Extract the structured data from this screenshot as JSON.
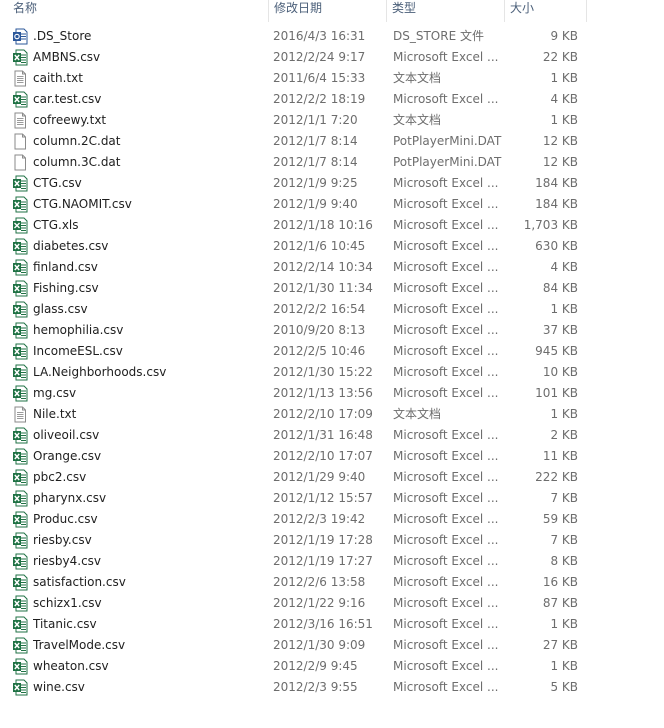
{
  "header": {
    "name_label": "名称",
    "date_label": "修改日期",
    "type_label": "类型",
    "size_label": "大小"
  },
  "colors": {
    "excel_green": "#1f7244",
    "header_text": "#4c607a",
    "secondary_text": "#6d6d6d"
  },
  "files": [
    {
      "name": ".DS_Store",
      "date": "2016/4/3 16:31",
      "type": "DS_STORE 文件",
      "size": "9 KB",
      "icon": "word-blue-icon"
    },
    {
      "name": "AMBNS.csv",
      "date": "2012/2/24 9:17",
      "type": "Microsoft Excel ...",
      "size": "22 KB",
      "icon": "excel-icon"
    },
    {
      "name": "caith.txt",
      "date": "2011/6/4 15:33",
      "type": "文本文档",
      "size": "1 KB",
      "icon": "text-file-icon"
    },
    {
      "name": "car.test.csv",
      "date": "2012/2/2 18:19",
      "type": "Microsoft Excel ...",
      "size": "4 KB",
      "icon": "excel-icon"
    },
    {
      "name": "cofreewy.txt",
      "date": "2012/1/1 7:20",
      "type": "文本文档",
      "size": "1 KB",
      "icon": "text-file-icon"
    },
    {
      "name": "column.2C.dat",
      "date": "2012/1/7 8:14",
      "type": "PotPlayerMini.DAT",
      "size": "12 KB",
      "icon": "blank-file-icon"
    },
    {
      "name": "column.3C.dat",
      "date": "2012/1/7 8:14",
      "type": "PotPlayerMini.DAT",
      "size": "12 KB",
      "icon": "blank-file-icon"
    },
    {
      "name": "CTG.csv",
      "date": "2012/1/9 9:25",
      "type": "Microsoft Excel ...",
      "size": "184 KB",
      "icon": "excel-icon"
    },
    {
      "name": "CTG.NAOMIT.csv",
      "date": "2012/1/9 9:40",
      "type": "Microsoft Excel ...",
      "size": "184 KB",
      "icon": "excel-icon"
    },
    {
      "name": "CTG.xls",
      "date": "2012/1/18 10:16",
      "type": "Microsoft Excel ...",
      "size": "1,703 KB",
      "icon": "excel-xls-icon"
    },
    {
      "name": "diabetes.csv",
      "date": "2012/1/6 10:45",
      "type": "Microsoft Excel ...",
      "size": "630 KB",
      "icon": "excel-icon"
    },
    {
      "name": "finland.csv",
      "date": "2012/2/14 10:34",
      "type": "Microsoft Excel ...",
      "size": "4 KB",
      "icon": "excel-icon"
    },
    {
      "name": "Fishing.csv",
      "date": "2012/1/30 11:34",
      "type": "Microsoft Excel ...",
      "size": "84 KB",
      "icon": "excel-icon"
    },
    {
      "name": "glass.csv",
      "date": "2012/2/2 16:54",
      "type": "Microsoft Excel ...",
      "size": "1 KB",
      "icon": "excel-icon"
    },
    {
      "name": "hemophilia.csv",
      "date": "2010/9/20 8:13",
      "type": "Microsoft Excel ...",
      "size": "37 KB",
      "icon": "excel-icon"
    },
    {
      "name": "IncomeESL.csv",
      "date": "2012/2/5 10:46",
      "type": "Microsoft Excel ...",
      "size": "945 KB",
      "icon": "excel-icon"
    },
    {
      "name": "LA.Neighborhoods.csv",
      "date": "2012/1/30 15:22",
      "type": "Microsoft Excel ...",
      "size": "10 KB",
      "icon": "excel-icon"
    },
    {
      "name": "mg.csv",
      "date": "2012/1/13 13:56",
      "type": "Microsoft Excel ...",
      "size": "101 KB",
      "icon": "excel-icon"
    },
    {
      "name": "Nile.txt",
      "date": "2012/2/10 17:09",
      "type": "文本文档",
      "size": "1 KB",
      "icon": "text-file-icon"
    },
    {
      "name": "oliveoil.csv",
      "date": "2012/1/31 16:48",
      "type": "Microsoft Excel ...",
      "size": "2 KB",
      "icon": "excel-icon"
    },
    {
      "name": "Orange.csv",
      "date": "2012/2/10 17:07",
      "type": "Microsoft Excel ...",
      "size": "11 KB",
      "icon": "excel-icon"
    },
    {
      "name": "pbc2.csv",
      "date": "2012/1/29 9:40",
      "type": "Microsoft Excel ...",
      "size": "222 KB",
      "icon": "excel-icon"
    },
    {
      "name": "pharynx.csv",
      "date": "2012/1/12 15:57",
      "type": "Microsoft Excel ...",
      "size": "7 KB",
      "icon": "excel-icon"
    },
    {
      "name": "Produc.csv",
      "date": "2012/2/3 19:42",
      "type": "Microsoft Excel ...",
      "size": "59 KB",
      "icon": "excel-icon"
    },
    {
      "name": "riesby.csv",
      "date": "2012/1/19 17:28",
      "type": "Microsoft Excel ...",
      "size": "7 KB",
      "icon": "excel-icon"
    },
    {
      "name": "riesby4.csv",
      "date": "2012/1/19 17:27",
      "type": "Microsoft Excel ...",
      "size": "8 KB",
      "icon": "excel-icon"
    },
    {
      "name": "satisfaction.csv",
      "date": "2012/2/6 13:58",
      "type": "Microsoft Excel ...",
      "size": "16 KB",
      "icon": "excel-icon"
    },
    {
      "name": "schizx1.csv",
      "date": "2012/1/22 9:16",
      "type": "Microsoft Excel ...",
      "size": "87 KB",
      "icon": "excel-icon"
    },
    {
      "name": "Titanic.csv",
      "date": "2012/3/16 16:51",
      "type": "Microsoft Excel ...",
      "size": "1 KB",
      "icon": "excel-icon"
    },
    {
      "name": "TravelMode.csv",
      "date": "2012/1/30 9:09",
      "type": "Microsoft Excel ...",
      "size": "27 KB",
      "icon": "excel-icon"
    },
    {
      "name": "wheaton.csv",
      "date": "2012/2/9 9:45",
      "type": "Microsoft Excel ...",
      "size": "1 KB",
      "icon": "excel-icon"
    },
    {
      "name": "wine.csv",
      "date": "2012/2/3 9:55",
      "type": "Microsoft Excel ...",
      "size": "5 KB",
      "icon": "excel-icon"
    }
  ]
}
